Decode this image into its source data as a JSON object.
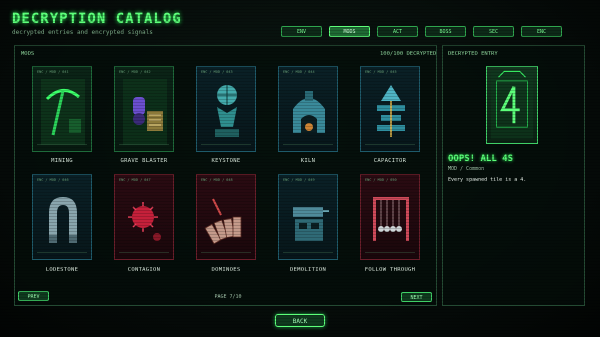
{
  "header": {
    "title": "DECRYPTION CATALOG",
    "subtitle": "decrypted entries and encrypted signals"
  },
  "tabs": [
    {
      "label": "ENV",
      "active": false
    },
    {
      "label": "MODS",
      "active": true
    },
    {
      "label": "ACT",
      "active": false
    },
    {
      "label": "BOSS",
      "active": false
    },
    {
      "label": "SEC",
      "active": false
    },
    {
      "label": "ENC",
      "active": false
    }
  ],
  "grid": {
    "label": "MODS",
    "count": "100/100 DECRYPTED",
    "cards": [
      {
        "name": "MINING",
        "icon": "pickaxe-icon",
        "color": "green"
      },
      {
        "name": "GRAVE BLASTER",
        "icon": "grave-blaster-icon",
        "color": "green"
      },
      {
        "name": "KEYSTONE",
        "icon": "atlas-statue-icon",
        "color": "cyan"
      },
      {
        "name": "KILN",
        "icon": "kiln-icon",
        "color": "cyan"
      },
      {
        "name": "CAPACITOR",
        "icon": "capacitor-icon",
        "color": "cyan"
      },
      {
        "name": "LODESTONE",
        "icon": "magnet-icon",
        "color": "cyan"
      },
      {
        "name": "CONTAGION",
        "icon": "virus-icon",
        "color": "red"
      },
      {
        "name": "DOMINOES",
        "icon": "dominoes-icon",
        "color": "red"
      },
      {
        "name": "DEMOLITION",
        "icon": "demolition-icon",
        "color": "cyan"
      },
      {
        "name": "FOLLOW THROUGH",
        "icon": "newtons-cradle-icon",
        "color": "red"
      }
    ]
  },
  "pagination": {
    "prev_label": "PREV",
    "next_label": "NEXT",
    "page_text": "PAGE 7/10"
  },
  "detail": {
    "header": "DECRYPTED ENTRY",
    "name": "OOPS! ALL 4S",
    "type": "MOD / Common",
    "description": "Every spawned tile is a 4."
  },
  "footer": {
    "back_label": "BACK"
  }
}
